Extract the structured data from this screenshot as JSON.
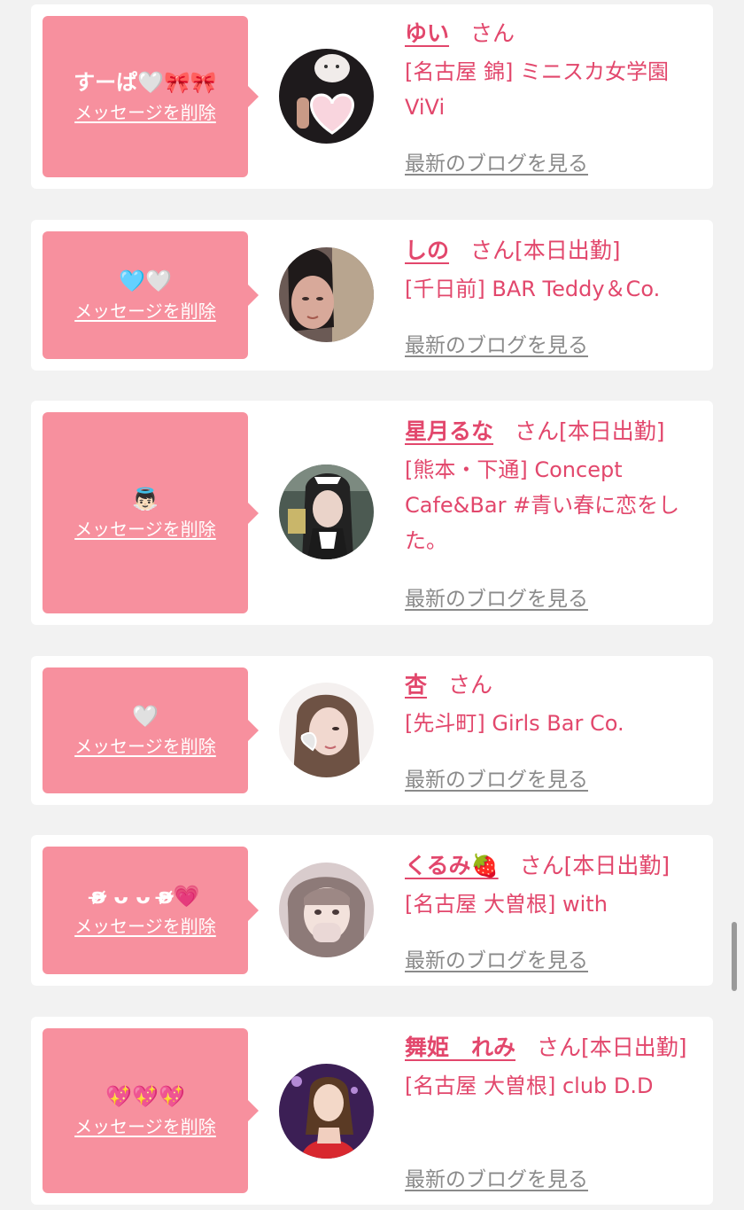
{
  "delete_label": "メッセージを削除",
  "blog_label": "最新のブログを見る",
  "san_label": "さん",
  "cards": [
    {
      "message": "すーぱ🤍🎀🎀",
      "name": "ゆい",
      "status": "",
      "shop": "[名古屋 錦] ミニスカ女学園ViVi",
      "avatar_icon": "girl-photo-icon"
    },
    {
      "message": "🩵🤍",
      "name": "しの",
      "status": "[本日出勤]",
      "shop": "[千日前] BAR Teddy＆Co.",
      "avatar_icon": "girl-photo-icon"
    },
    {
      "message": "👼🏻",
      "name": "星月るな",
      "status": "[本日出勤]",
      "shop": "[熊本・下通] Concept Cafe&Bar #青い春に恋をした。",
      "avatar_icon": "girl-photo-icon"
    },
    {
      "message": "🤍",
      "name": "杏",
      "status": "",
      "shop": "[先斗町] Girls Bar Co.",
      "avatar_icon": "girl-photo-icon"
    },
    {
      "message": "ʚ̴̶̷̷ ᴗ ᴗ ʚ̴̶̷̷💗",
      "name": "くるみ🍓",
      "status": "[本日出勤]",
      "shop": "[名古屋 大曽根] with",
      "avatar_icon": "girl-photo-icon"
    },
    {
      "message": "💖💖💖",
      "name": "舞姫　れみ",
      "status": "[本日出勤]",
      "shop": "[名古屋 大曽根] club D.D",
      "avatar_icon": "girl-photo-icon"
    }
  ],
  "colors": {
    "accent": "#e2476c",
    "bubble": "#f7909e",
    "background": "#f2f2f2",
    "link_gray": "#8a8a8a"
  }
}
